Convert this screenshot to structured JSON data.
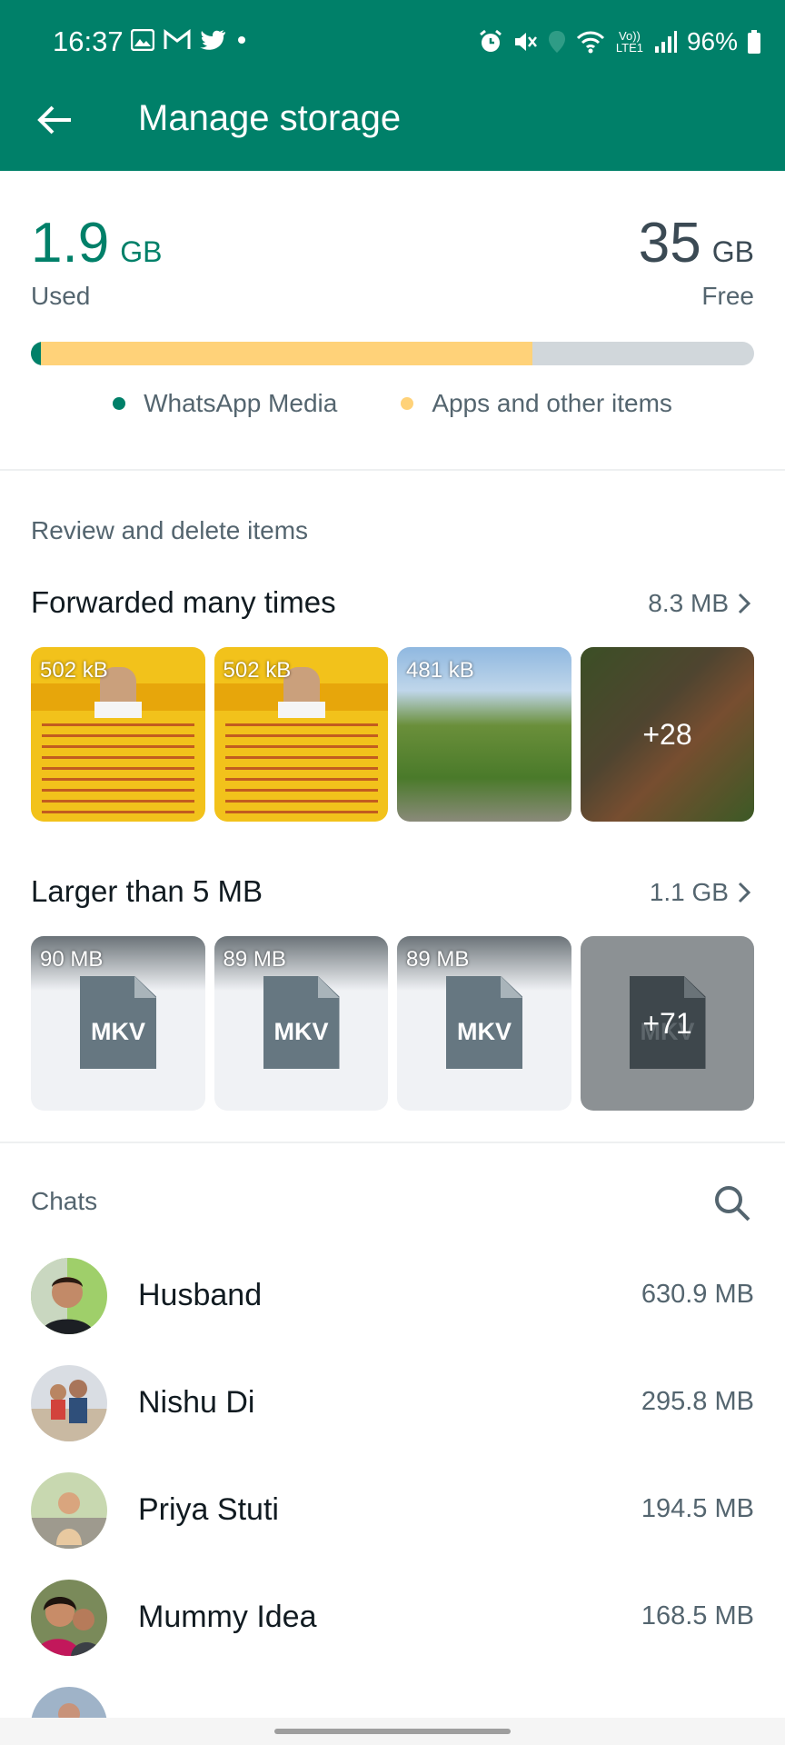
{
  "status_bar": {
    "time": "16:37",
    "battery": "96%",
    "network": "Vo)) LTE1",
    "left_icons": [
      "gallery-icon",
      "gmail-icon",
      "twitter-icon",
      "dot-icon"
    ],
    "right_icons": [
      "alarm-icon",
      "mute-icon",
      "location-icon",
      "wifi-icon",
      "signal-icon",
      "battery-icon"
    ]
  },
  "app_bar": {
    "title": "Manage storage"
  },
  "storage": {
    "used_value": "1.9",
    "used_unit": "GB",
    "used_label": "Used",
    "free_value": "35",
    "free_unit": "GB",
    "free_label": "Free",
    "bar": {
      "whatsapp_media_fraction": 0.014,
      "apps_fraction": 0.68
    },
    "legend": [
      {
        "label": "WhatsApp Media",
        "color": "#008069"
      },
      {
        "label": "Apps and other items",
        "color": "#ffd279"
      }
    ]
  },
  "review": {
    "heading": "Review and delete items",
    "forwarded": {
      "label": "Forwarded many times",
      "size": "8.3 MB",
      "items": [
        {
          "size": "502 kB"
        },
        {
          "size": "502 kB"
        },
        {
          "size": "481 kB"
        },
        {
          "more": "+28"
        }
      ]
    },
    "larger": {
      "label": "Larger than 5 MB",
      "size": "1.1 GB",
      "items": [
        {
          "size": "90 MB",
          "ext": "MKV"
        },
        {
          "size": "89 MB",
          "ext": "MKV"
        },
        {
          "size": "89 MB",
          "ext": "MKV"
        },
        {
          "ext": "MKV",
          "more": "+71"
        }
      ]
    }
  },
  "chats": {
    "heading": "Chats",
    "items": [
      {
        "name": "Husband",
        "size": "630.9 MB"
      },
      {
        "name": "Nishu Di",
        "size": "295.8 MB"
      },
      {
        "name": "Priya Stuti",
        "size": "194.5 MB"
      },
      {
        "name": "Mummy Idea",
        "size": "168.5 MB"
      }
    ]
  }
}
